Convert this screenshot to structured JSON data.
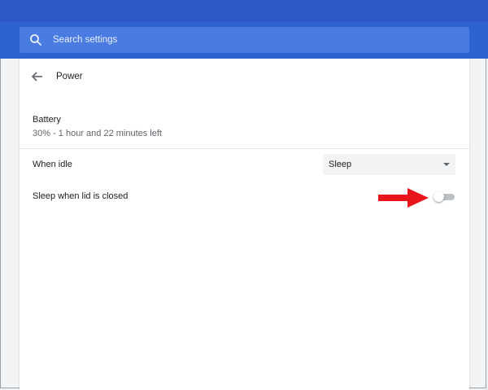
{
  "search": {
    "placeholder": "Search settings",
    "icon": "search-icon"
  },
  "page": {
    "title": "Power",
    "back_icon": "arrow-back-icon"
  },
  "battery": {
    "label": "Battery",
    "status": "30% - 1 hour and 22 minutes left"
  },
  "when_idle": {
    "label": "When idle",
    "selected": "Sleep"
  },
  "lid": {
    "label": "Sleep when lid is closed",
    "enabled": false
  },
  "colors": {
    "header": "#2f62d1",
    "search_bg": "#4a7be0",
    "annotation_arrow": "#e8151b",
    "toggle_off": "#bdc1c6"
  }
}
